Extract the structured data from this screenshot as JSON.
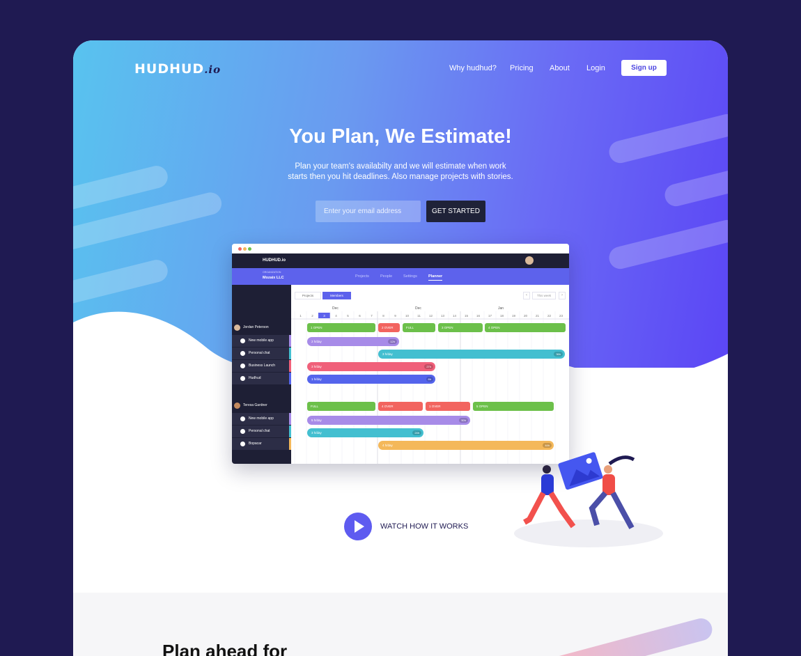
{
  "brand": {
    "name": "HUDHUD",
    "suffix": ".io"
  },
  "nav": {
    "items": [
      "Why hudhud?",
      "Pricing",
      "About",
      "Login"
    ],
    "signup": "Sign up"
  },
  "hero": {
    "title": "You Plan, We Estimate!",
    "subtitle_line1": "Plan your team's availabilty and we will estimate when work",
    "subtitle_line2": "starts then you hit deadlines. Also manage projects with stories.",
    "email_placeholder": "Enter your email address",
    "cta": "GET STARTED"
  },
  "app": {
    "brand": "HUDHUD.io",
    "org_label": "ORGANIZATION",
    "org_name": "Mozaix LLC",
    "tabs": [
      "Projects",
      "People",
      "Settings",
      "Planner"
    ],
    "toggle": [
      "Projects",
      "Members"
    ],
    "range": "This week",
    "months": [
      "Dec",
      "Dec",
      "Jan"
    ],
    "days": [
      "1",
      "2",
      "3",
      "4",
      "5",
      "6",
      "7",
      "8",
      "9",
      "10",
      "11",
      "12",
      "13",
      "14",
      "15",
      "16",
      "17",
      "18",
      "19",
      "20",
      "21",
      "22",
      "23"
    ],
    "members": [
      {
        "name": "Jordan Peterson",
        "projects": [
          "New mobile app",
          "Personal chat",
          "Business Launch",
          "Hudhud"
        ],
        "status": [
          "1 OPEN",
          "2 OVER",
          "FULL",
          "3 OPEN",
          "4 OPEN"
        ],
        "pills": [
          {
            "label": "2 h/day",
            "hours": "12h"
          },
          {
            "label": "3 h/day",
            "hours": "36h"
          },
          {
            "label": "3 h/day",
            "hours": "27h"
          },
          {
            "label": "1 h/day",
            "hours": "8h"
          }
        ]
      },
      {
        "name": "Teresa Gardner",
        "projects": [
          "New mobile app",
          "Personal chat",
          "Bopacar"
        ],
        "status": [
          "FULL",
          "4 OVER",
          "1 OVER",
          "5 OPEN"
        ],
        "pills": [
          {
            "label": "5 h/day",
            "hours": "50h"
          },
          {
            "label": "3 h/day",
            "hours": "24h"
          },
          {
            "label": "4 h/day",
            "hours": "44h"
          }
        ]
      }
    ]
  },
  "watch": "WATCH HOW IT WORKS",
  "section2": {
    "heading": "Plan ahead for"
  },
  "colors": {
    "green": "#6cc04a",
    "red": "#f2645f",
    "purple": "#a78be8",
    "teal": "#43bfd0",
    "pink": "#f0607a",
    "blue": "#5464ec",
    "orange": "#f4b85a",
    "navy": "#1f1a52",
    "accent": "#5e5bf0"
  }
}
